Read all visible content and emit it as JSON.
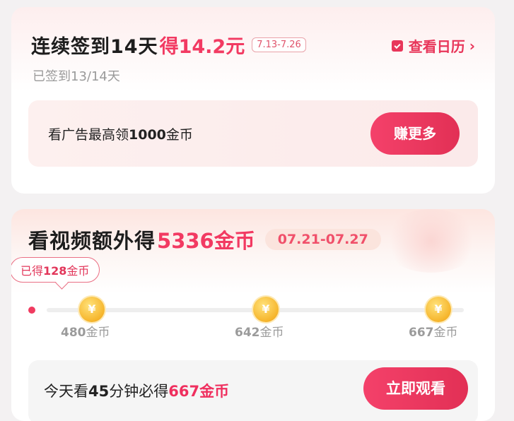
{
  "checkin": {
    "title_prefix": "连续签到14天",
    "title_reward": "得14.2元",
    "date_range": "7.13-7.26",
    "calendar_link": "查看日历",
    "progress": "已签到13/14天",
    "ad_text_a": "看广告最高领",
    "ad_text_b": "1000",
    "ad_text_c": "金币",
    "earn_button": "赚更多"
  },
  "video": {
    "title_prefix": "看视频额外得",
    "title_reward": "5336金币",
    "date_range": "07.21-07.27",
    "earned_a": "已得",
    "earned_b": "128",
    "earned_c": "金币",
    "coin_symbol": "¥",
    "milestones": [
      {
        "amount": "480",
        "unit": "金币"
      },
      {
        "amount": "642",
        "unit": "金币"
      },
      {
        "amount": "667",
        "unit": "金币"
      }
    ],
    "watch_text_a": "今天看",
    "watch_text_b": "45",
    "watch_text_c": "分钟必得",
    "watch_text_d": "667金币",
    "watch_button": "立即观看"
  },
  "colors": {
    "accent": "#f23a62",
    "coin": "#f6b52c"
  },
  "icons": [
    "calendar-check-icon",
    "chevron-right-icon",
    "coin-icon"
  ]
}
